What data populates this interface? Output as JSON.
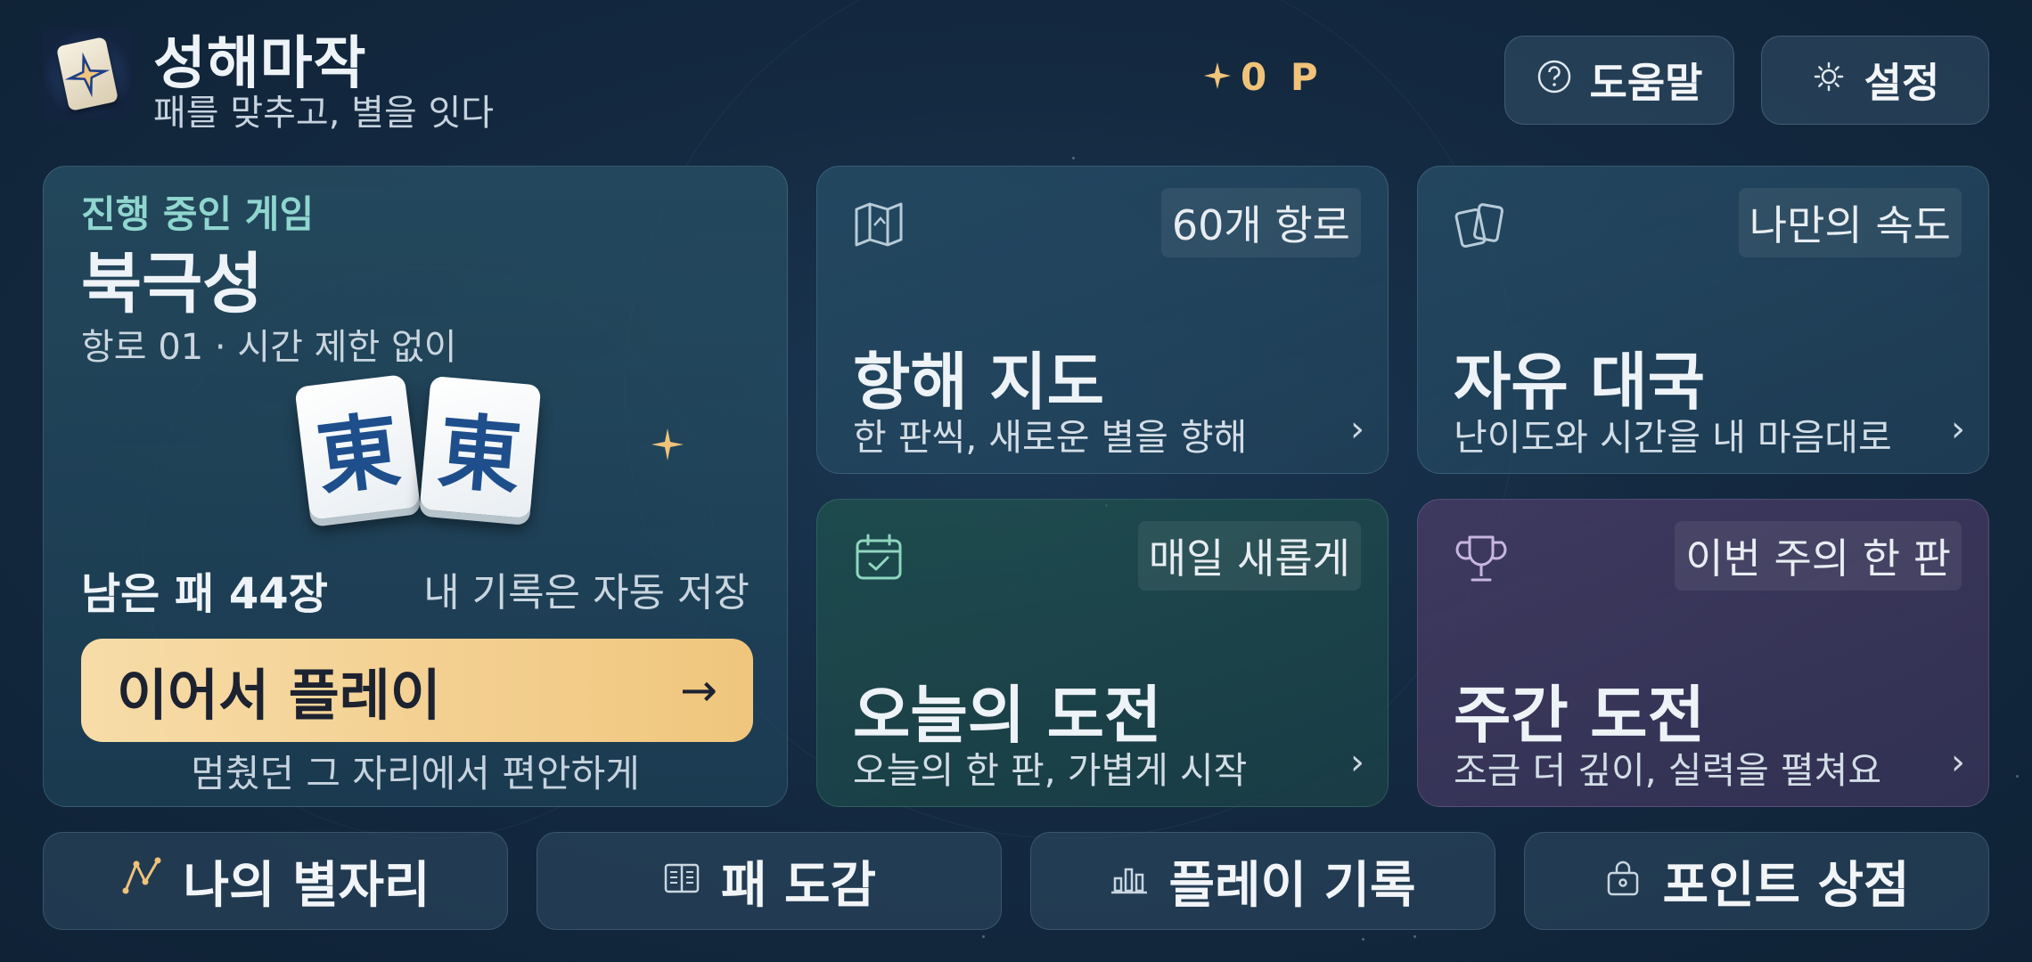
{
  "header": {
    "title": "성해마작",
    "subtitle": "패를 맞추고, 별을 잇다",
    "points": "0 P",
    "help_label": "도움말",
    "settings_label": "설정"
  },
  "continue_card": {
    "label": "진행 중인 게임",
    "title": "북극성",
    "subtitle": "항로 01 · 시간 제한 없이",
    "tile_char": "東",
    "remaining": "남은 패 44장",
    "autosave": "내 기록은 자동 저장",
    "play_label": "이어서 플레이",
    "play_arrow": "→",
    "hint": "멈췄던 그 자리에서 편안하게"
  },
  "modes": [
    {
      "icon": "map-icon",
      "badge": "60개 항로",
      "title": "항해 지도",
      "desc": "한 판씩, 새로운 별을 향해",
      "chevron": "›"
    },
    {
      "icon": "cards-icon",
      "badge": "나만의 속도",
      "title": "자유 대국",
      "desc": "난이도와 시간을 내 마음대로",
      "chevron": "›"
    },
    {
      "icon": "calendar-check-icon",
      "badge": "매일 새롭게",
      "title": "오늘의 도전",
      "desc": "오늘의 한 판, 가볍게 시작",
      "chevron": "›"
    },
    {
      "icon": "trophy-icon",
      "badge": "이번 주의 한 판",
      "title": "주간 도전",
      "desc": "조금 더 깊이, 실력을 펼쳐요",
      "chevron": "›"
    }
  ],
  "bottom_nav": [
    {
      "icon": "constellation-icon",
      "label": "나의 별자리"
    },
    {
      "icon": "book-icon",
      "label": "패 도감"
    },
    {
      "icon": "bar-chart-icon",
      "label": "플레이 기록"
    },
    {
      "icon": "shop-bag-icon",
      "label": "포인트 상점"
    }
  ],
  "colors": {
    "background": "#142a41",
    "accent_gold": "#f0c67d",
    "label_teal": "#8fd6cf",
    "tile_blue": "#1e4f8c"
  }
}
